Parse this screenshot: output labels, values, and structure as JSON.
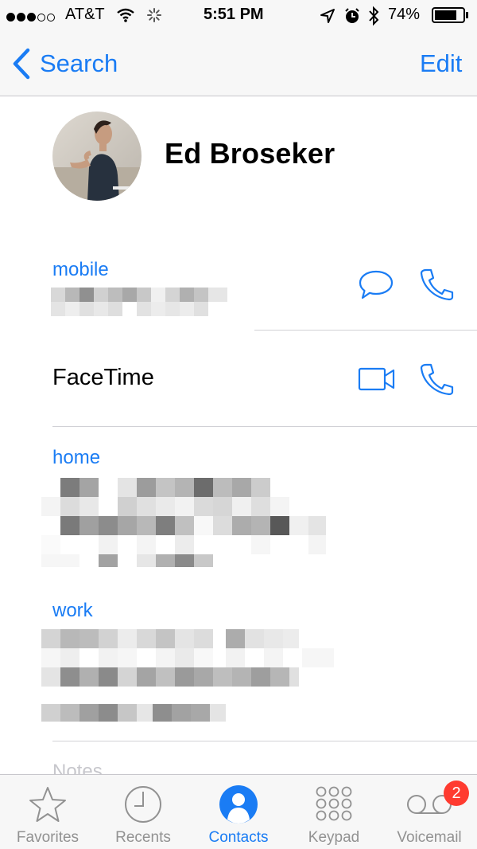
{
  "status_bar": {
    "carrier": "AT&T",
    "time": "5:51 PM",
    "battery_percent": "74%",
    "battery_level": 0.74,
    "signal_bars_filled": 3,
    "signal_bars_total": 5,
    "icons": [
      "wifi-icon",
      "activity-spinner-icon",
      "location-icon",
      "alarm-icon",
      "bluetooth-icon",
      "battery-icon"
    ]
  },
  "nav": {
    "back_label": "Search",
    "edit_label": "Edit"
  },
  "contact": {
    "name": "Ed Broseker"
  },
  "fields": {
    "mobile_label": "mobile",
    "facetime_label": "FaceTime",
    "home_label": "home",
    "work_label": "work",
    "notes_label": "Notes"
  },
  "tabs": [
    {
      "label": "Favorites",
      "icon": "star-icon",
      "active": false
    },
    {
      "label": "Recents",
      "icon": "clock-icon",
      "active": false
    },
    {
      "label": "Contacts",
      "icon": "person-icon",
      "active": true
    },
    {
      "label": "Keypad",
      "icon": "keypad-icon",
      "active": false
    },
    {
      "label": "Voicemail",
      "icon": "voicemail-icon",
      "active": false,
      "badge": "2"
    }
  ],
  "colors": {
    "accent": "#1a7cf4",
    "badge": "#ff3b30",
    "tab_inactive": "#929292"
  }
}
